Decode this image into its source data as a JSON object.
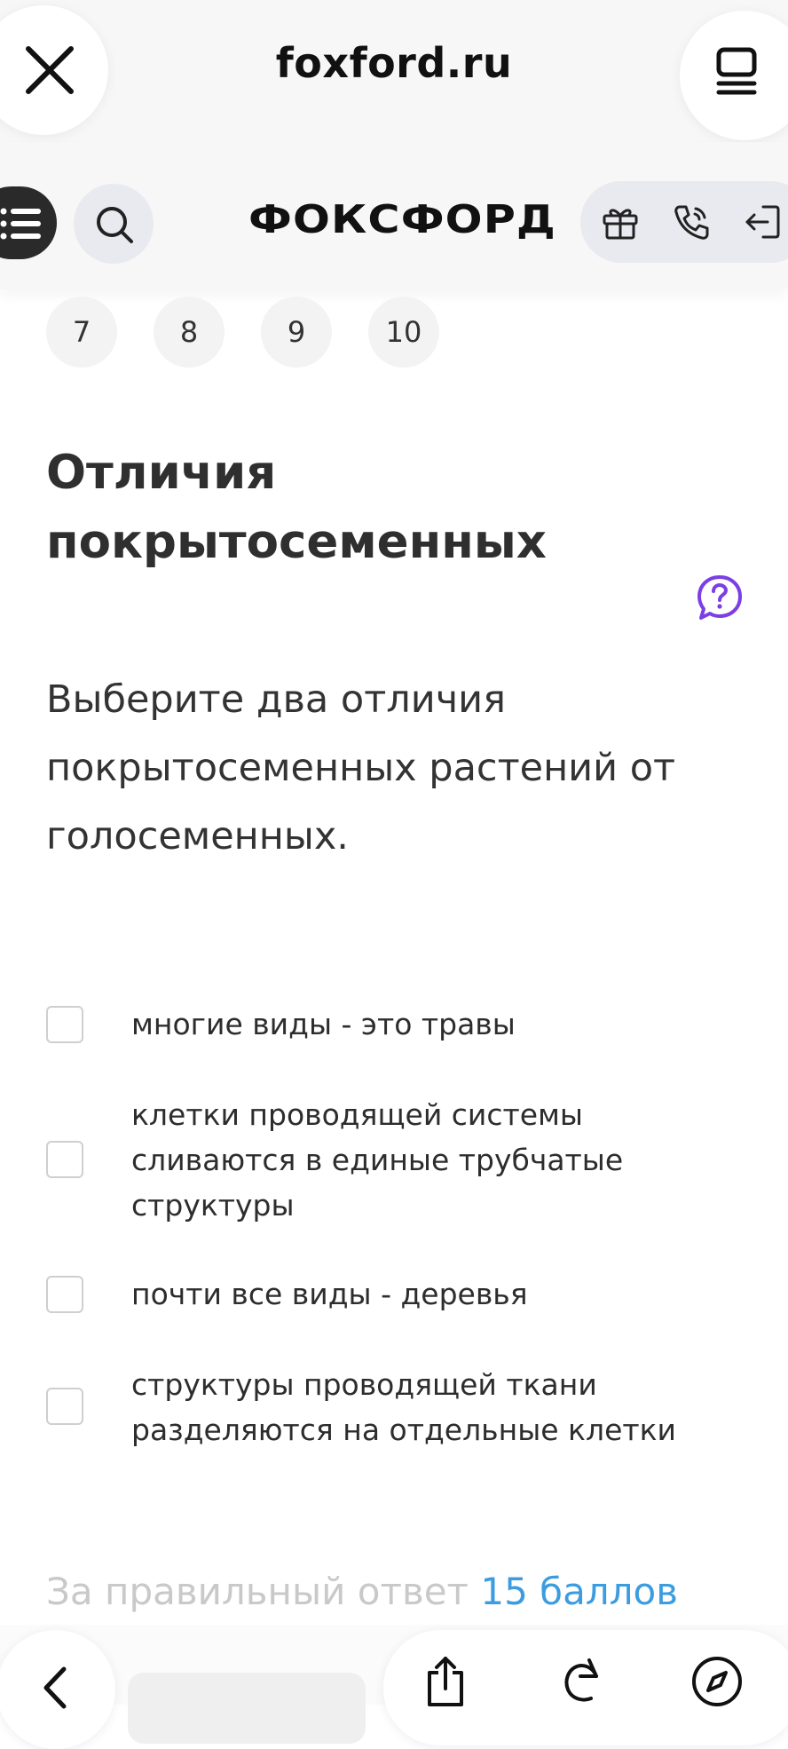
{
  "browser": {
    "url": "foxford.ru"
  },
  "header": {
    "logo": "ФОКСФОРД"
  },
  "pagination": [
    "7",
    "8",
    "9",
    "10"
  ],
  "task": {
    "title": "Отличия покрытосеменных",
    "question": "Выберите два отличия покрытосеменных растений от голосеменных.",
    "options": [
      {
        "label": "многие виды - это травы",
        "checked": false
      },
      {
        "label": "клетки проводящей системы сливаются в единые трубчатые структуры",
        "checked": false
      },
      {
        "label": "почти все виды - деревья",
        "checked": false
      },
      {
        "label": "структуры проводящей ткани разделяются на отдельные клетки",
        "checked": false
      }
    ],
    "score_prefix": "За правильный ответ",
    "score_points": "15 баллов"
  },
  "colors": {
    "accent_purple": "#7b3fe4",
    "points_blue": "#3b9de0"
  },
  "icons": [
    "close-icon",
    "tabs-icon",
    "menu-icon",
    "search-icon",
    "gift-icon",
    "phone-icon",
    "login-icon",
    "help-icon",
    "back-icon",
    "share-icon",
    "reload-icon",
    "compass-icon"
  ]
}
